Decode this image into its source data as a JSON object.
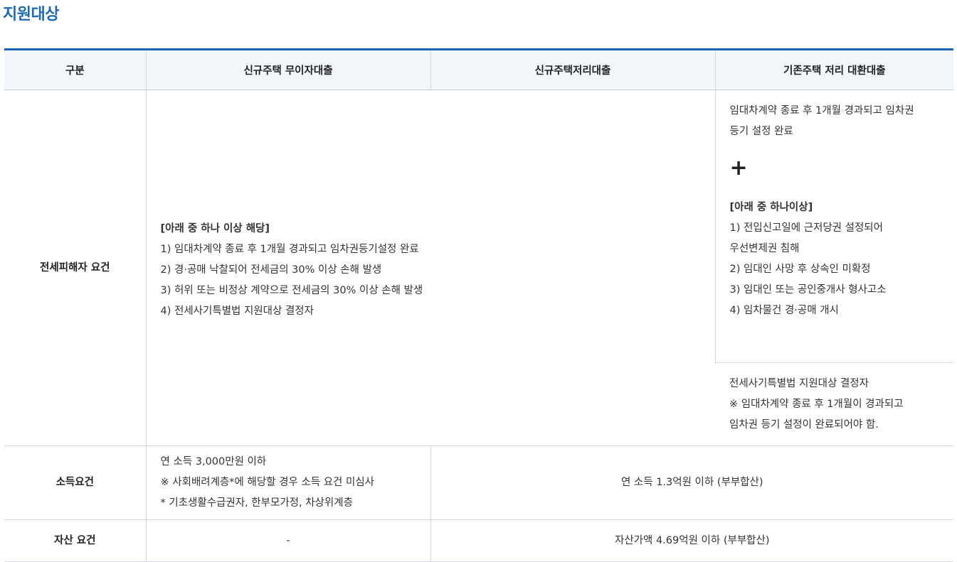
{
  "title": "지원대상",
  "headers": [
    "구분",
    "신규주택 무이자대출",
    "신규주택저리대출",
    "기존주택 저리 대환대출"
  ],
  "victim_row": {
    "label": "전세피해자 요건",
    "new_housing": {
      "heading": "[아래 중 하나 이상 해당]",
      "items": [
        "1) 임대차계약 종료 후 1개월 경과되고 임차권등기설정 완료",
        "2) 경·공매 낙찰되어 전세금의 30% 이상 손해 발생",
        "3) 허위 또는 비정상 계약으로 전세금의 30% 이상 손해 발생",
        "4) 전세사기특별법 지원대상 결정자"
      ]
    },
    "existing_top": {
      "lines": [
        "임대차계약 종료 후 1개월 경과되고 임차권",
        "등기 설정 완료"
      ],
      "plus": "+",
      "heading": "[아래 중 하나이상]",
      "items": [
        "1) 전입신고일에 근저당권 설정되어",
        "우선변제권 침해",
        "2) 임대인 사망 후 상속인 미확정",
        "3) 임대인 또는 공인중개사 형사고소",
        "4) 임차물건 경·공매 개시"
      ]
    },
    "existing_bottom": {
      "lines": [
        "전세사기특별법 지원대상 결정자",
        "※ 임대차계약 종료 후 1개월이 경과되고",
        "임차권 등기 설정이 완료되어야 함."
      ]
    }
  },
  "income_row": {
    "label": "소득요건",
    "free_loan": [
      "연 소득 3,000만원 이하",
      "※ 사회배려계층*에 해당할 경우 소득 요건 미심사",
      "* 기초생활수급권자, 한부모가정, 차상위계층"
    ],
    "others": "연 소득 1.3억원 이하 (부부합산)"
  },
  "asset_row": {
    "label": "자산 요건",
    "free_loan": "-",
    "others": "자산가액 4.69억원 이하 (부부합산)"
  }
}
